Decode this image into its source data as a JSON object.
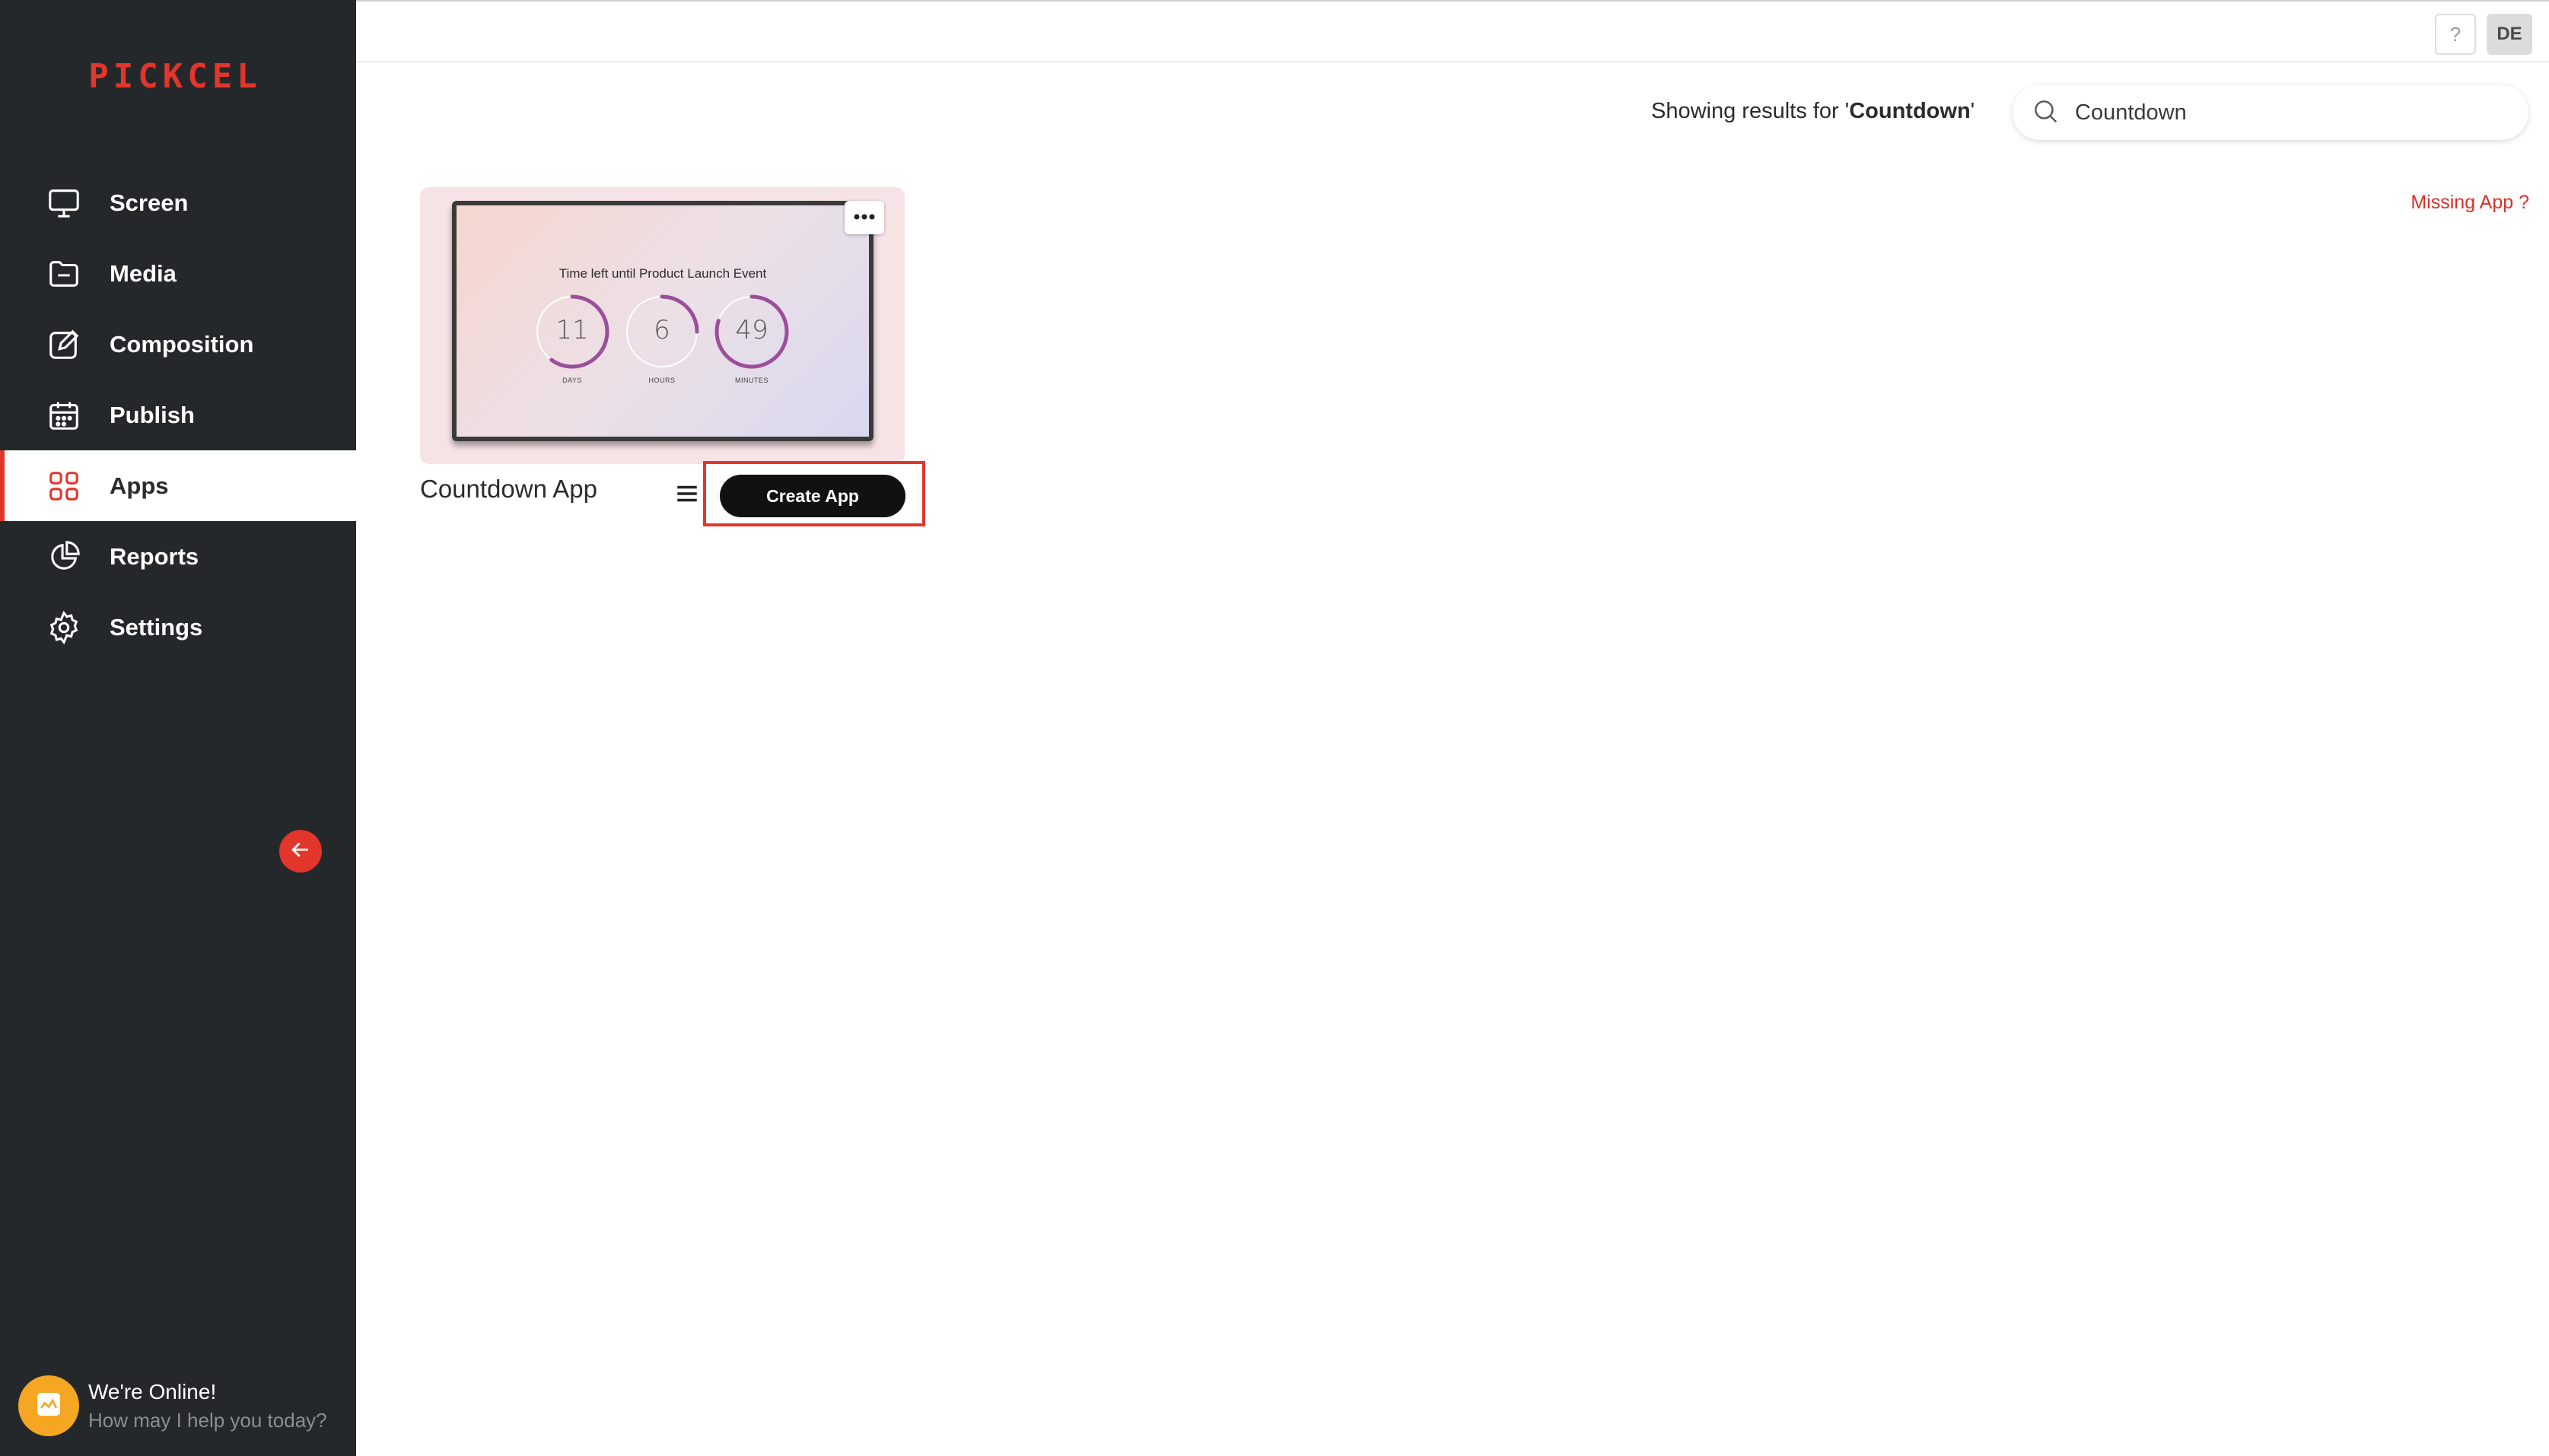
{
  "brand": {
    "logo_text": "PICKCEL",
    "accent": "#e2352b"
  },
  "sidebar": {
    "items": [
      {
        "label": "Screen",
        "icon": "monitor-icon"
      },
      {
        "label": "Media",
        "icon": "folder-icon"
      },
      {
        "label": "Composition",
        "icon": "edit-icon"
      },
      {
        "label": "Publish",
        "icon": "calendar-icon"
      },
      {
        "label": "Apps",
        "icon": "grid-icon",
        "active": true
      },
      {
        "label": "Reports",
        "icon": "pie-chart-icon"
      },
      {
        "label": "Settings",
        "icon": "gear-icon"
      }
    ],
    "collapse_icon": "arrow-left-icon"
  },
  "chat": {
    "title": "We're Online!",
    "subtitle": "How may I help you today?"
  },
  "header": {
    "help_label": "?",
    "user_initials": "DE"
  },
  "search": {
    "results_prefix": "Showing results for '",
    "results_query": "Countdown",
    "results_suffix": "'",
    "value": "Countdown"
  },
  "missing_app_label": "Missing App ?",
  "app_card": {
    "name": "Countdown App",
    "preview": {
      "headline": "Time left until Product Launch Event",
      "rings": [
        {
          "value": "11",
          "unit": "DAYS",
          "fill": 0.6
        },
        {
          "value": "6",
          "unit": "HOURS",
          "fill": 0.25
        },
        {
          "value": "49",
          "unit": "MINUTES",
          "fill": 0.8
        }
      ],
      "ring_color": "#9b4f9a"
    },
    "create_label": "Create App"
  }
}
